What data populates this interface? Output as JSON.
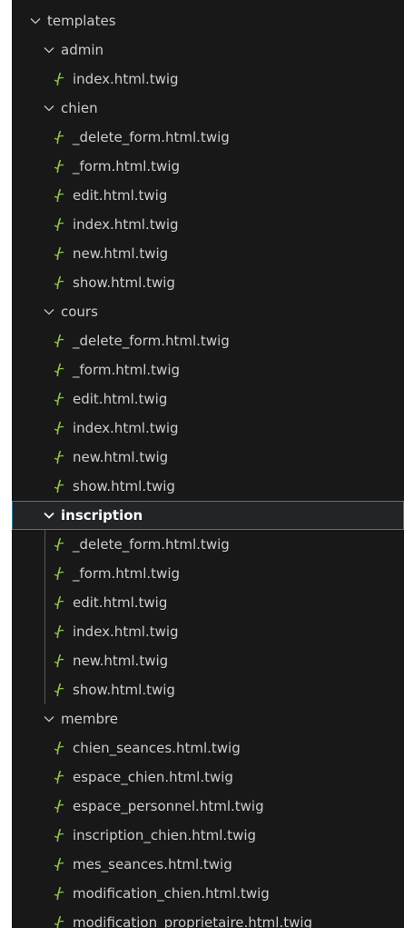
{
  "explorer": {
    "root": {
      "name": "templates",
      "icon": "chevron-down-icon"
    },
    "folders": [
      {
        "name": "admin",
        "files": [
          "index.html.twig"
        ]
      },
      {
        "name": "chien",
        "files": [
          "_delete_form.html.twig",
          "_form.html.twig",
          "edit.html.twig",
          "index.html.twig",
          "new.html.twig",
          "show.html.twig"
        ]
      },
      {
        "name": "cours",
        "files": [
          "_delete_form.html.twig",
          "_form.html.twig",
          "edit.html.twig",
          "index.html.twig",
          "new.html.twig",
          "show.html.twig"
        ]
      },
      {
        "name": "inscription",
        "selected": true,
        "files": [
          "_delete_form.html.twig",
          "_form.html.twig",
          "edit.html.twig",
          "index.html.twig",
          "new.html.twig",
          "show.html.twig"
        ]
      },
      {
        "name": "membre",
        "files": [
          "chien_seances.html.twig",
          "espace_chien.html.twig",
          "espace_personnel.html.twig",
          "inscription_chien.html.twig",
          "mes_seances.html.twig",
          "modification_chien.html.twig",
          "modification_proprietaire.html.twig"
        ]
      }
    ],
    "file_icon": "twig-file-icon",
    "colors": {
      "background": "#181818",
      "text": "#cccccc",
      "twig_icon": "#8dc149",
      "selection_border": "#2d7f9e",
      "indent_guide": "#585858"
    }
  }
}
